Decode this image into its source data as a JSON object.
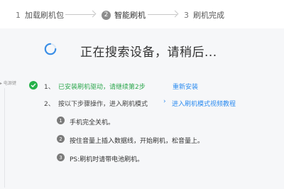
{
  "steps": [
    {
      "num": "1",
      "label": "加载刷机包"
    },
    {
      "num": "2",
      "label": "智能刷机"
    },
    {
      "num": "3",
      "label": "刷机完成"
    }
  ],
  "status": {
    "title": "正在搜索设备，请稍后...",
    "side_label": "电源键"
  },
  "items": [
    {
      "num": "1、",
      "text": "已安装刷机驱动，请继续第2步",
      "link": "重新安装"
    },
    {
      "num": "2、",
      "text": "按以下步骤操作，进入刷机模式",
      "chevron": "›",
      "link": "进入刷机模式视频教程"
    }
  ],
  "substeps": [
    {
      "num": "1",
      "text": "手机完全关机。"
    },
    {
      "num": "2",
      "text": "按住音量上插入数据线，开始刷机，松音量上。"
    },
    {
      "num": "3",
      "text": "PS:刷机时请带电池刷机。"
    }
  ],
  "colors": {
    "success": "#2fa84f",
    "link": "#2d8cf0",
    "panel_bg": "#f6f7f9"
  }
}
